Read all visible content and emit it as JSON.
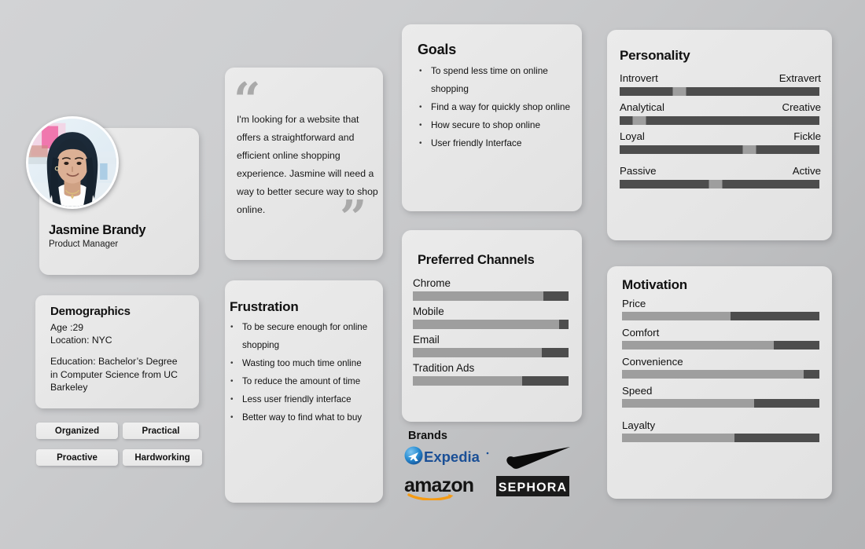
{
  "profile": {
    "name": "Jasmine Brandy",
    "role": "Product Manager",
    "avatar_icon": "user-photo"
  },
  "demographics": {
    "title": "Demographics",
    "age": "Age :29",
    "location": "Location: NYC",
    "education": "Education: Bachelor’s Degree in Computer Science from UC Barkeley"
  },
  "traits": [
    {
      "label": "Organized"
    },
    {
      "label": "Practical"
    },
    {
      "label": "Proactive"
    },
    {
      "label": "Hardworking"
    }
  ],
  "quote": {
    "open_mark": "“",
    "close_mark": "”",
    "text": "I'm looking for a website that offers a straightforward and efficient online shopping experience. Jasmine will need a way to better secure way to shop online."
  },
  "frustration": {
    "title": "Frustration",
    "items": [
      "To be secure enough for online shopping",
      "Wasting too much time online",
      "To reduce the amount of time",
      "Less user friendly interface",
      "Better way to find what to buy"
    ]
  },
  "goals": {
    "title": "Goals",
    "items": [
      "To spend less time on online shopping",
      "Find a way for quickly shop online",
      "How secure to shop online",
      "User friendly Interface"
    ]
  },
  "channels": {
    "title": "Preferred Channels",
    "items": [
      {
        "label": "Chrome",
        "value": 84
      },
      {
        "label": "Mobile",
        "value": 94
      },
      {
        "label": "Email",
        "value": 83
      },
      {
        "label": "Tradition Ads",
        "value": 70
      }
    ]
  },
  "brands": {
    "title": "Brands",
    "items": [
      {
        "name": "expedia-logo",
        "label": "Expedia"
      },
      {
        "name": "nike-logo",
        "label": "Nike"
      },
      {
        "name": "amazon-logo",
        "label": "amazon"
      },
      {
        "name": "sephora-logo",
        "label": "SEPHORA"
      }
    ]
  },
  "personality": {
    "title": "Personality",
    "items": [
      {
        "left": "Introvert",
        "right": "Extravert",
        "value": 30
      },
      {
        "left": "Analytical",
        "right": "Creative",
        "value": 10
      },
      {
        "left": "Loyal",
        "right": "Fickle",
        "value": 65
      },
      {
        "left": "Passive",
        "right": "Active",
        "value": 48
      }
    ]
  },
  "motivation": {
    "title": "Motivation",
    "items": [
      {
        "label": "Price",
        "value": 55
      },
      {
        "label": "Comfort",
        "value": 77
      },
      {
        "label": "Convenience",
        "value": 92
      },
      {
        "label": "Speed",
        "value": 67
      },
      {
        "label": "Layalty",
        "value": 57
      }
    ]
  },
  "colors": {
    "card_bg": "#e7e7e7",
    "track_dark": "#4d4d4d",
    "fill_light": "#9e9e9e",
    "text": "#111111",
    "page_bg": "#cdced0"
  }
}
